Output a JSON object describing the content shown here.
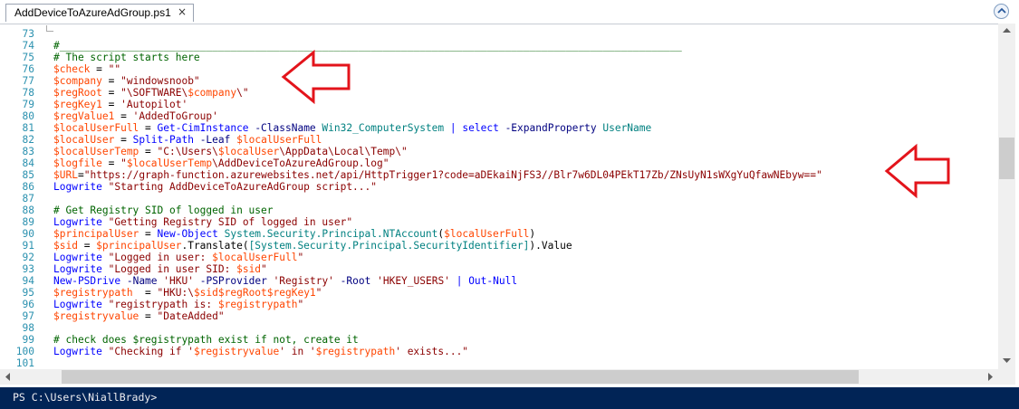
{
  "tab": {
    "title": "AddDeviceToAzureAdGroup.ps1",
    "close_glyph": "×"
  },
  "colors": {
    "variable": "#ff4500",
    "string": "#8b0000",
    "comment": "#006400",
    "command": "#0000ff",
    "type": "#008080",
    "parameter": "#000080",
    "member": "#000000",
    "operator": "#a9a9a9",
    "line_number": "#2b91af",
    "annotation_arrow": "#e3141b",
    "console_bg": "#012456"
  },
  "editor": {
    "lines": [
      {
        "n": "73",
        "tokens": []
      },
      {
        "n": "74",
        "tokens": [
          [
            "comment",
            "#______________________________________________________________________________________________________"
          ]
        ]
      },
      {
        "n": "75",
        "tokens": [
          [
            "comment",
            "# The script starts here"
          ]
        ]
      },
      {
        "n": "76",
        "tokens": [
          [
            "variable",
            "$check"
          ],
          [
            "plain",
            " = "
          ],
          [
            "string",
            "\"\""
          ]
        ]
      },
      {
        "n": "77",
        "tokens": [
          [
            "variable",
            "$company"
          ],
          [
            "plain",
            " = "
          ],
          [
            "string",
            "\"windowsnoob\""
          ]
        ]
      },
      {
        "n": "78",
        "tokens": [
          [
            "variable",
            "$regRoot"
          ],
          [
            "plain",
            " = "
          ],
          [
            "string",
            "\"\\SOFTWARE\\"
          ],
          [
            "variable",
            "$company"
          ],
          [
            "string",
            "\\\""
          ]
        ]
      },
      {
        "n": "79",
        "tokens": [
          [
            "variable",
            "$regKey1"
          ],
          [
            "plain",
            " = "
          ],
          [
            "string",
            "'Autopilot'"
          ]
        ]
      },
      {
        "n": "80",
        "tokens": [
          [
            "variable",
            "$regValue1"
          ],
          [
            "plain",
            " = "
          ],
          [
            "string",
            "'AddedToGroup'"
          ]
        ]
      },
      {
        "n": "81",
        "tokens": [
          [
            "variable",
            "$localUserFull"
          ],
          [
            "plain",
            " = "
          ],
          [
            "command",
            "Get-CimInstance"
          ],
          [
            "plain",
            " "
          ],
          [
            "parameter",
            "-ClassName"
          ],
          [
            "plain",
            " "
          ],
          [
            "type",
            "Win32_ComputerSystem"
          ],
          [
            "plain",
            " "
          ],
          [
            "command",
            "|"
          ],
          [
            "plain",
            " "
          ],
          [
            "command",
            "select"
          ],
          [
            "plain",
            " "
          ],
          [
            "parameter",
            "-ExpandProperty"
          ],
          [
            "plain",
            " "
          ],
          [
            "type",
            "UserName"
          ]
        ]
      },
      {
        "n": "82",
        "tokens": [
          [
            "variable",
            "$localUser"
          ],
          [
            "plain",
            " = "
          ],
          [
            "command",
            "Split-Path"
          ],
          [
            "plain",
            " "
          ],
          [
            "parameter",
            "-Leaf"
          ],
          [
            "plain",
            " "
          ],
          [
            "variable",
            "$localUserFull"
          ]
        ]
      },
      {
        "n": "83",
        "tokens": [
          [
            "variable",
            "$localUserTemp"
          ],
          [
            "plain",
            " = "
          ],
          [
            "string",
            "\"C:\\Users\\"
          ],
          [
            "variable",
            "$localUser"
          ],
          [
            "string",
            "\\AppData\\Local\\Temp\\\""
          ]
        ]
      },
      {
        "n": "84",
        "tokens": [
          [
            "variable",
            "$logfile"
          ],
          [
            "plain",
            " = "
          ],
          [
            "string",
            "\""
          ],
          [
            "variable",
            "$localUserTemp"
          ],
          [
            "string",
            "\\AddDeviceToAzureAdGroup.log\""
          ]
        ]
      },
      {
        "n": "85",
        "tokens": [
          [
            "variable",
            "$URL"
          ],
          [
            "plain",
            "="
          ],
          [
            "string",
            "\"https://graph-function.azurewebsites.net/api/HttpTrigger1?code=aDEkaiNjFS3//Blr7w6DL04PEkT17Zb/ZNsUyN1sWXgYuQfawNEbyw==\""
          ]
        ]
      },
      {
        "n": "86",
        "tokens": [
          [
            "command",
            "Logwrite"
          ],
          [
            "plain",
            " "
          ],
          [
            "string",
            "\"Starting AddDeviceToAzureAdGroup script...\""
          ]
        ]
      },
      {
        "n": "87",
        "tokens": []
      },
      {
        "n": "88",
        "tokens": [
          [
            "comment",
            "# Get Registry SID of logged in user"
          ]
        ]
      },
      {
        "n": "89",
        "tokens": [
          [
            "command",
            "Logwrite"
          ],
          [
            "plain",
            " "
          ],
          [
            "string",
            "\"Getting Registry SID of logged in user\""
          ]
        ]
      },
      {
        "n": "90",
        "tokens": [
          [
            "variable",
            "$principalUser"
          ],
          [
            "plain",
            " = "
          ],
          [
            "command",
            "New-Object"
          ],
          [
            "plain",
            " "
          ],
          [
            "type",
            "System.Security.Principal.NTAccount"
          ],
          [
            "plain",
            "("
          ],
          [
            "variable",
            "$localUserFull"
          ],
          [
            "plain",
            ")"
          ]
        ]
      },
      {
        "n": "91",
        "tokens": [
          [
            "variable",
            "$sid"
          ],
          [
            "plain",
            " = "
          ],
          [
            "variable",
            "$principalUser"
          ],
          [
            "plain",
            ".Translate("
          ],
          [
            "type",
            "[System.Security.Principal.SecurityIdentifier]"
          ],
          [
            "plain",
            ").Value"
          ]
        ]
      },
      {
        "n": "92",
        "tokens": [
          [
            "command",
            "Logwrite"
          ],
          [
            "plain",
            " "
          ],
          [
            "string",
            "\"Logged in user: "
          ],
          [
            "variable",
            "$localUserFull"
          ],
          [
            "string",
            "\""
          ]
        ]
      },
      {
        "n": "93",
        "tokens": [
          [
            "command",
            "Logwrite"
          ],
          [
            "plain",
            " "
          ],
          [
            "string",
            "\"Logged in user SID: "
          ],
          [
            "variable",
            "$sid"
          ],
          [
            "string",
            "\""
          ]
        ]
      },
      {
        "n": "94",
        "tokens": [
          [
            "command",
            "New-PSDrive"
          ],
          [
            "plain",
            " "
          ],
          [
            "parameter",
            "-Name"
          ],
          [
            "plain",
            " "
          ],
          [
            "string",
            "'HKU'"
          ],
          [
            "plain",
            " "
          ],
          [
            "parameter",
            "-PSProvider"
          ],
          [
            "plain",
            " "
          ],
          [
            "string",
            "'Registry'"
          ],
          [
            "plain",
            " "
          ],
          [
            "parameter",
            "-Root"
          ],
          [
            "plain",
            " "
          ],
          [
            "string",
            "'HKEY_USERS'"
          ],
          [
            "plain",
            " "
          ],
          [
            "command",
            "|"
          ],
          [
            "plain",
            " "
          ],
          [
            "command",
            "Out-Null"
          ]
        ]
      },
      {
        "n": "95",
        "tokens": [
          [
            "variable",
            "$registrypath"
          ],
          [
            "plain",
            "  = "
          ],
          [
            "string",
            "\"HKU:\\"
          ],
          [
            "variable",
            "$sid"
          ],
          [
            "variable",
            "$regRoot"
          ],
          [
            "variable",
            "$regKey1"
          ],
          [
            "string",
            "\""
          ]
        ]
      },
      {
        "n": "96",
        "tokens": [
          [
            "command",
            "Logwrite"
          ],
          [
            "plain",
            " "
          ],
          [
            "string",
            "\"registrypath is: "
          ],
          [
            "variable",
            "$registrypath"
          ],
          [
            "string",
            "\""
          ]
        ]
      },
      {
        "n": "97",
        "tokens": [
          [
            "variable",
            "$registryvalue"
          ],
          [
            "plain",
            " = "
          ],
          [
            "string",
            "\"DateAdded\""
          ]
        ]
      },
      {
        "n": "98",
        "tokens": []
      },
      {
        "n": "99",
        "tokens": [
          [
            "comment",
            "# check does $registrypath exist if not, create it"
          ]
        ]
      },
      {
        "n": "100",
        "tokens": [
          [
            "command",
            "Logwrite"
          ],
          [
            "plain",
            " "
          ],
          [
            "string",
            "\"Checking if '"
          ],
          [
            "variable",
            "$registryvalue"
          ],
          [
            "string",
            "' in '"
          ],
          [
            "variable",
            "$registrypath"
          ],
          [
            "string",
            "' exists...\""
          ]
        ]
      },
      {
        "n": "101",
        "tokens": []
      }
    ]
  },
  "console": {
    "prompt": "PS C:\\Users\\NiallBrady>"
  }
}
